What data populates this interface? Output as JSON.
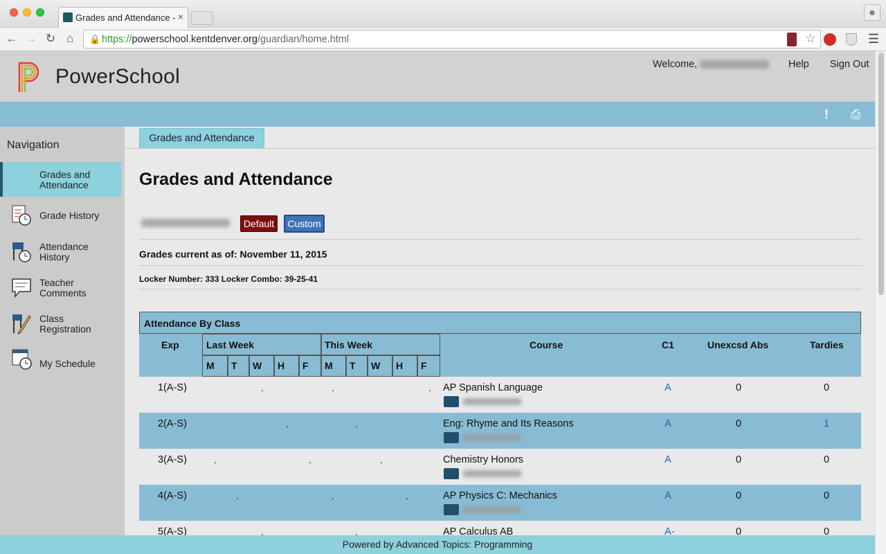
{
  "browser": {
    "tab_title": "Grades and Attendance - P",
    "tab_close": "×",
    "url_scheme": "https://",
    "url_host": "powerschool.kentdenver.org",
    "url_path": "/guardian/home.html"
  },
  "header": {
    "logo_text": "PowerSchool",
    "welcome_label": "Welcome,",
    "help_label": "Help",
    "signout_label": "Sign Out"
  },
  "sidebar": {
    "title": "Navigation",
    "items": [
      {
        "label_line1": "Grades and",
        "label_line2": "Attendance"
      },
      {
        "label_line1": "Grade History",
        "label_line2": ""
      },
      {
        "label_line1": "Attendance",
        "label_line2": "History"
      },
      {
        "label_line1": "Teacher",
        "label_line2": "Comments"
      },
      {
        "label_line1": "Class",
        "label_line2": "Registration"
      },
      {
        "label_line1": "My Schedule",
        "label_line2": ""
      }
    ]
  },
  "main": {
    "tab_label": "Grades and Attendance",
    "page_title": "Grades and Attendance",
    "default_button": "Default",
    "custom_button": "Custom",
    "grades_current": "Grades current as of: November 11, 2015",
    "locker_info": "Locker Number: 333 Locker Combo: 39-25-41"
  },
  "attendance": {
    "caption": "Attendance By Class",
    "headers": {
      "exp": "Exp",
      "last_week": "Last Week",
      "this_week": "This Week",
      "course": "Course",
      "term": "C1",
      "abs": "Unexcsd Abs",
      "tardies": "Tardies"
    },
    "days": [
      "M",
      "T",
      "W",
      "H",
      "F",
      "M",
      "T",
      "W",
      "H",
      "F"
    ],
    "rows": [
      {
        "exp": "1(A-S)",
        "course": "AP Spanish Language",
        "grade": "A",
        "abs": "0",
        "tardies": "0"
      },
      {
        "exp": "2(A-S)",
        "course": "Eng: Rhyme and Its Reasons",
        "grade": "A",
        "abs": "0",
        "tardies": "1"
      },
      {
        "exp": "3(A-S)",
        "course": "Chemistry Honors",
        "grade": "A",
        "abs": "0",
        "tardies": "0"
      },
      {
        "exp": "4(A-S)",
        "course": "AP Physics C: Mechanics",
        "grade": "A",
        "abs": "0",
        "tardies": "0"
      },
      {
        "exp": "5(A-S)",
        "course": "AP Calculus AB",
        "grade": "A-",
        "abs": "0",
        "tardies": "0"
      }
    ],
    "dot": "."
  },
  "footer": {
    "text": "Powered by Advanced Topics: Programming"
  }
}
